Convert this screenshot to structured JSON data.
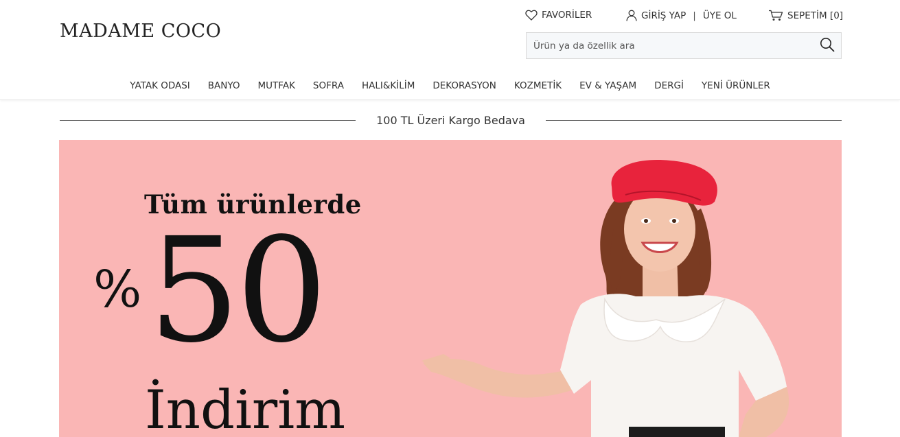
{
  "brand": {
    "logo_text": "MADAME COCO"
  },
  "toplinks": {
    "favorites": "FAVORİLER",
    "login": "GİRİŞ YAP",
    "separator": "|",
    "register": "ÜYE OL",
    "cart": "SEPETİM [0]"
  },
  "search": {
    "placeholder": "Ürün ya da özellik ara",
    "value": ""
  },
  "nav": {
    "items": [
      {
        "label": "YATAK ODASI"
      },
      {
        "label": "BANYO"
      },
      {
        "label": "MUTFAK"
      },
      {
        "label": "SOFRA"
      },
      {
        "label": "HALI&KİLİM"
      },
      {
        "label": "DEKORASYON"
      },
      {
        "label": "KOZMETİK"
      },
      {
        "label": "EV & YAŞAM"
      },
      {
        "label": "DERGİ"
      },
      {
        "label": "YENİ ÜRÜNLER"
      }
    ]
  },
  "shipping_banner": {
    "text": "100 TL Üzeri Kargo Bedava"
  },
  "hero": {
    "headline": "Tüm ürünlerde",
    "percent_sign": "%",
    "discount": "50",
    "word": "İndirim",
    "background_color": "#fab6b5",
    "beret_color": "#e8233c"
  },
  "icons": {
    "favorites": "heart-icon",
    "login": "user-icon",
    "cart": "cart-icon",
    "search": "search-icon"
  }
}
